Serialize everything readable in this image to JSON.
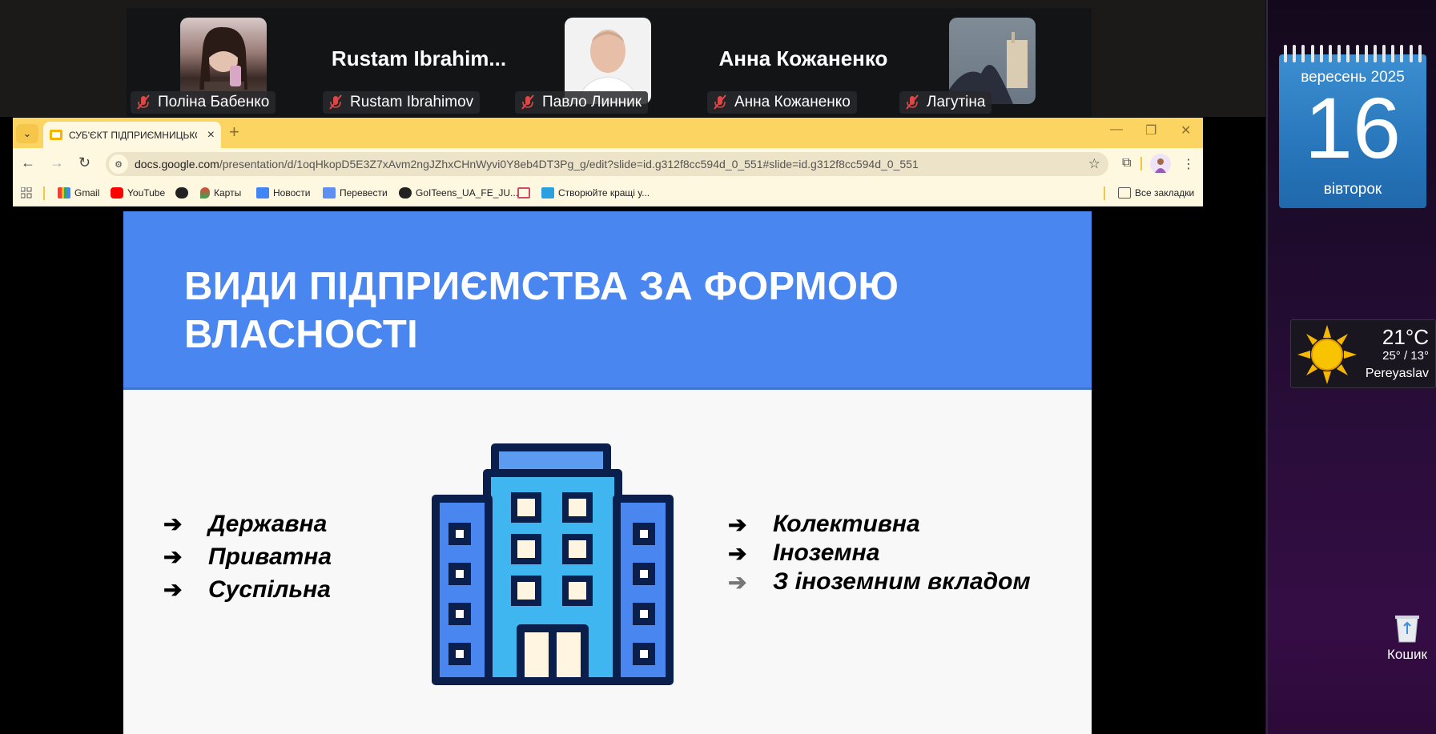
{
  "meeting": {
    "participants": [
      {
        "name": "Поліна Бабенко",
        "muted": true
      },
      {
        "name": "Rustam Ibrahimov",
        "display_name": "Rustam  Ibrahim...",
        "muted": true
      },
      {
        "name": "Павло Линник",
        "muted": true
      },
      {
        "name": "Анна Кожаненко",
        "display_name": "Анна Кожаненко",
        "muted": true
      },
      {
        "name": "Лагутіна",
        "muted": true
      }
    ]
  },
  "browser": {
    "tab_title": "СУБ'ЄКТ ПІДПРИЄМНИЦЬКОЇ",
    "url_host": "docs.google.com",
    "url_path": "/presentation/d/1oqHkopD5E3Z7xAvm2ngJZhxCHnWyvi0Y8eb4DT3Pg_g/edit?slide=id.g312f8cc594d_0_551#slide=id.g312f8cc594d_0_551",
    "bookmarks": [
      {
        "label": "Gmail",
        "icon": "gmail-icon"
      },
      {
        "label": "YouTube",
        "icon": "youtube-icon"
      },
      {
        "label": "",
        "icon": "github-icon"
      },
      {
        "label": "Карты",
        "icon": "maps-icon"
      },
      {
        "label": "Новости",
        "icon": "news-icon"
      },
      {
        "label": "Перевести",
        "icon": "translate-icon"
      },
      {
        "label": "GoITeens_UA_FE_JU...",
        "icon": "skype-icon"
      },
      {
        "label": "",
        "icon": "gift-icon"
      },
      {
        "label": "Створюйте кращі у...",
        "icon": "grid-icon"
      }
    ],
    "all_bookmarks_label": "Все закладки"
  },
  "slide": {
    "title": "ВИДИ ПІДПРИЄМСТВА ЗА ФОРМОЮ ВЛАСНОСТІ",
    "left_list": [
      "Державна",
      "Приватна",
      "Суспільна"
    ],
    "right_list": [
      "Колективна",
      "Іноземна",
      "З іноземним вкладом"
    ]
  },
  "desktop": {
    "calendar": {
      "month_year": "вересень 2025",
      "day": "16",
      "weekday": "вівторок"
    },
    "weather": {
      "temp": "21°C",
      "range": "25° / 13°",
      "city": "Pereyaslav"
    },
    "trash_label": "Кошик"
  },
  "colors": {
    "slide_header": "#4a86f0",
    "tabstrip": "#fcd462",
    "calendar": "#2a78bd"
  }
}
